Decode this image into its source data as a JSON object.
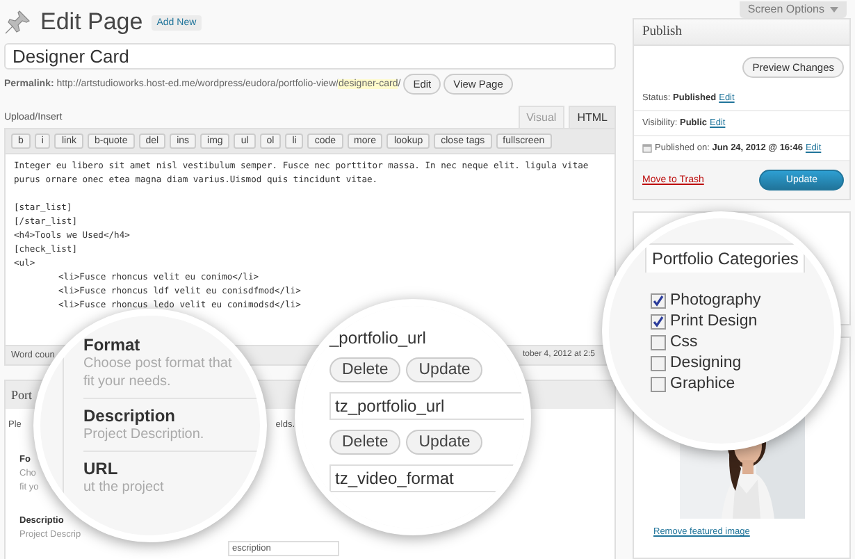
{
  "header": {
    "title": "Edit Page",
    "add_new": "Add New",
    "screen_options": "Screen Options"
  },
  "title_field": {
    "value": "Designer Card"
  },
  "permalink": {
    "label": "Permalink:",
    "url": "http://artstudioworks.host-ed.me/wordpress/eudora/portfolio-view/",
    "slug": "designer-card",
    "end": "/",
    "buttons": [
      "Edit",
      "View Page"
    ]
  },
  "upload_insert": "Upload/Insert",
  "editor_tabs": [
    {
      "label": "Visual",
      "selected": false
    },
    {
      "label": "HTML",
      "selected": true
    }
  ],
  "toolbar": [
    "b",
    "i",
    "link",
    "b-quote",
    "del",
    "ins",
    "img",
    "ul",
    "ol",
    "li",
    "code",
    "more",
    "lookup",
    "close tags",
    "fullscreen"
  ],
  "editor": {
    "paragraph": "Integer eu libero sit amet nisl vestibulum semper. Fusce nec porttitor massa. In nec neque elit. ligula vitae purus ornare onec etea magna diam varius.Uismod quis tincidunt vitae.",
    "code_lines": [
      {
        "text": "[star_list]",
        "indented": false
      },
      {
        "text": "[/star_list]",
        "indented": false
      },
      {
        "text": "<h4>Tools we Used</h4>",
        "indented": false
      },
      {
        "text": "[check_list]",
        "indented": false
      },
      {
        "text": "<ul>",
        "indented": false
      },
      {
        "text": "<li>Fusce rhoncus velit eu conimo</li>",
        "indented": true
      },
      {
        "text": "<li>Fusce rhoncus ldf velit eu conisdfmod</li>",
        "indented": true
      },
      {
        "text": "<li>Fusce rhoncus ledo velit eu conimodsd</li>",
        "indented": true
      }
    ]
  },
  "editor_footer": {
    "word_count": "Word coun",
    "last_edited": "tober 4, 2012 at 2:5"
  },
  "portfolio_box": {
    "title": "Port",
    "intro_start": "Ple",
    "intro_end": "elds.",
    "field_1_label": "Fo",
    "field_1_hint": [
      "Cho",
      "fit yo"
    ],
    "field_2_label": "Descriptio",
    "field_2_hint": "Project Descrip",
    "field_2_value": "escription"
  },
  "publish": {
    "title": "Publish",
    "preview": "Preview Changes",
    "rows": [
      {
        "kind": "plain",
        "label": "Status:",
        "value": "Published",
        "link": "Edit"
      },
      {
        "kind": "plain",
        "label": "Visibility:",
        "value": "Public",
        "link": "Edit"
      },
      {
        "kind": "date",
        "label": "Published on:",
        "value": "Jun 24, 2012 @ 16:46",
        "link": "Edit"
      }
    ],
    "trash": "Move to Trash",
    "update": "Update"
  },
  "featured_image": {
    "remove": "Remove featured image"
  },
  "lens_fields": {
    "items": [
      {
        "kind": "heading",
        "text": "Format"
      },
      {
        "kind": "hint",
        "text": "Choose post format that"
      },
      {
        "kind": "hint",
        "text": "fit your needs."
      },
      {
        "kind": "divider"
      },
      {
        "kind": "heading",
        "text": "Description"
      },
      {
        "kind": "hint",
        "text": "Project Description."
      },
      {
        "kind": "divider"
      },
      {
        "kind": "heading",
        "text": "URL"
      },
      {
        "kind": "hint",
        "text": "ut the project"
      }
    ]
  },
  "lens_custom_fields": {
    "items": [
      {
        "kind": "text",
        "text": "_portfolio_url"
      },
      {
        "kind": "buttons",
        "buttons": [
          "Delete",
          "Update"
        ]
      },
      {
        "kind": "input",
        "text": "tz_portfolio_url"
      },
      {
        "kind": "buttons",
        "buttons": [
          "Delete",
          "Update"
        ]
      },
      {
        "kind": "input",
        "text": "tz_video_format"
      }
    ]
  },
  "lens_categories": {
    "title": "Portfolio Categories",
    "items": [
      {
        "label": "Photography",
        "checked": true
      },
      {
        "label": "Print Design",
        "checked": true
      },
      {
        "label": "Css",
        "checked": false
      },
      {
        "label": "Designing",
        "checked": false
      },
      {
        "label": "Graphice",
        "checked": false
      }
    ]
  }
}
